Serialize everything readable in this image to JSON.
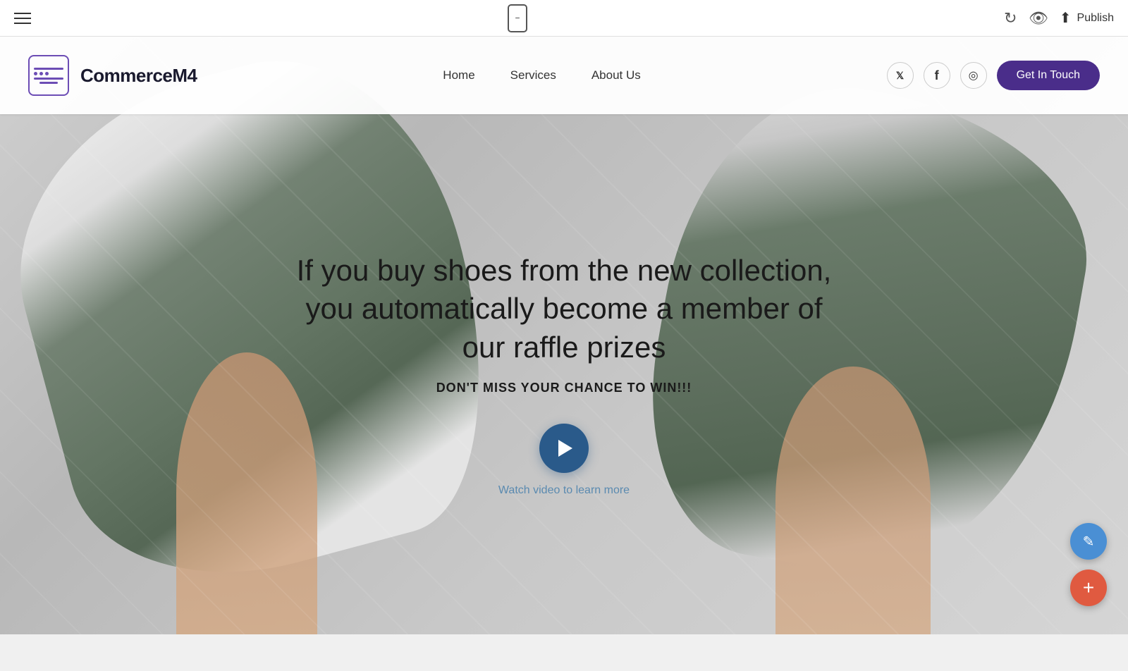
{
  "toolbar": {
    "publish_label": "Publish",
    "hamburger_name": "hamburger-menu",
    "phone_preview_name": "mobile-preview",
    "undo_name": "undo-button",
    "eye_name": "preview-button"
  },
  "nav": {
    "logo_text": "CommerceM4",
    "links": [
      {
        "label": "Home",
        "href": "#"
      },
      {
        "label": "Services",
        "href": "#"
      },
      {
        "label": "About Us",
        "href": "#"
      }
    ],
    "social": [
      {
        "name": "twitter",
        "symbol": "𝕏"
      },
      {
        "name": "facebook",
        "symbol": "f"
      },
      {
        "name": "instagram",
        "symbol": "◎"
      }
    ],
    "cta_label": "Get In Touch"
  },
  "hero": {
    "headline": "If you buy shoes from the new collection, you automatically become a member of our raffle prizes",
    "subheadline": "DON'T MISS YOUR CHANCE TO WIN!!!",
    "watch_video_label": "Watch video to learn more"
  },
  "fabs": {
    "pencil_label": "✎",
    "plus_label": "+"
  }
}
